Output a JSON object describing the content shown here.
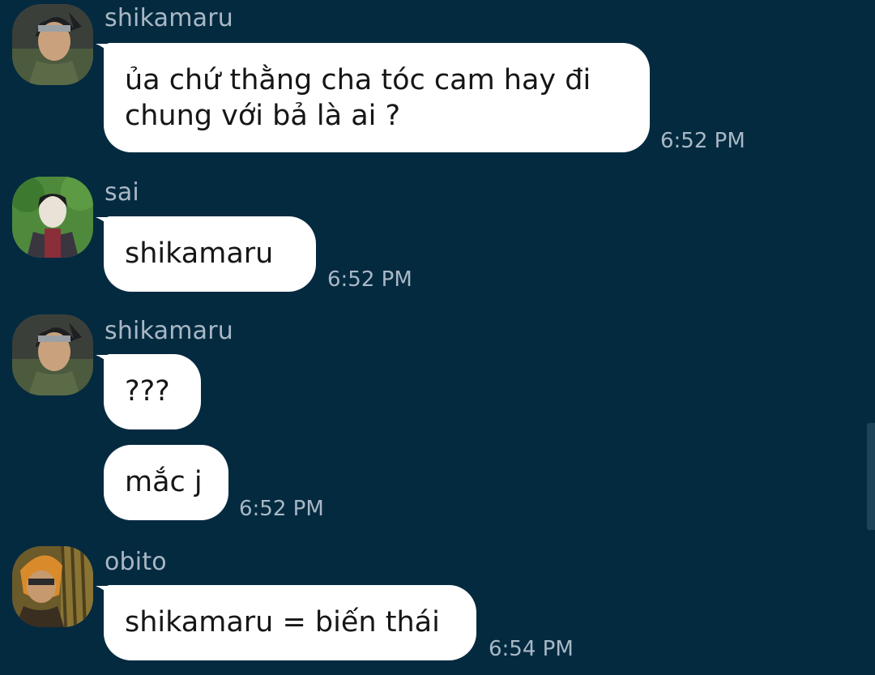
{
  "messages": [
    {
      "sender": "shikamaru",
      "avatar": "shikamaru-avatar",
      "bubbles": [
        {
          "line1": "ủa chứ thằng cha tóc cam hay đi",
          "line2": "chung với bả là ai ?"
        }
      ],
      "time": "6:52 PM"
    },
    {
      "sender": "sai",
      "avatar": "sai-avatar",
      "bubbles": [
        {
          "text": "shikamaru"
        }
      ],
      "time": "6:52 PM"
    },
    {
      "sender": "shikamaru",
      "avatar": "shikamaru-avatar",
      "bubbles": [
        {
          "text": "???"
        },
        {
          "text": "mắc j"
        }
      ],
      "time": "6:52 PM"
    },
    {
      "sender": "obito",
      "avatar": "obito-avatar",
      "bubbles": [
        {
          "text": "shikamaru = biến thái"
        }
      ],
      "time": "6:54 PM"
    }
  ],
  "colors": {
    "background": "#042a40",
    "bubble": "#ffffff",
    "meta_text": "#a9b8c4"
  }
}
